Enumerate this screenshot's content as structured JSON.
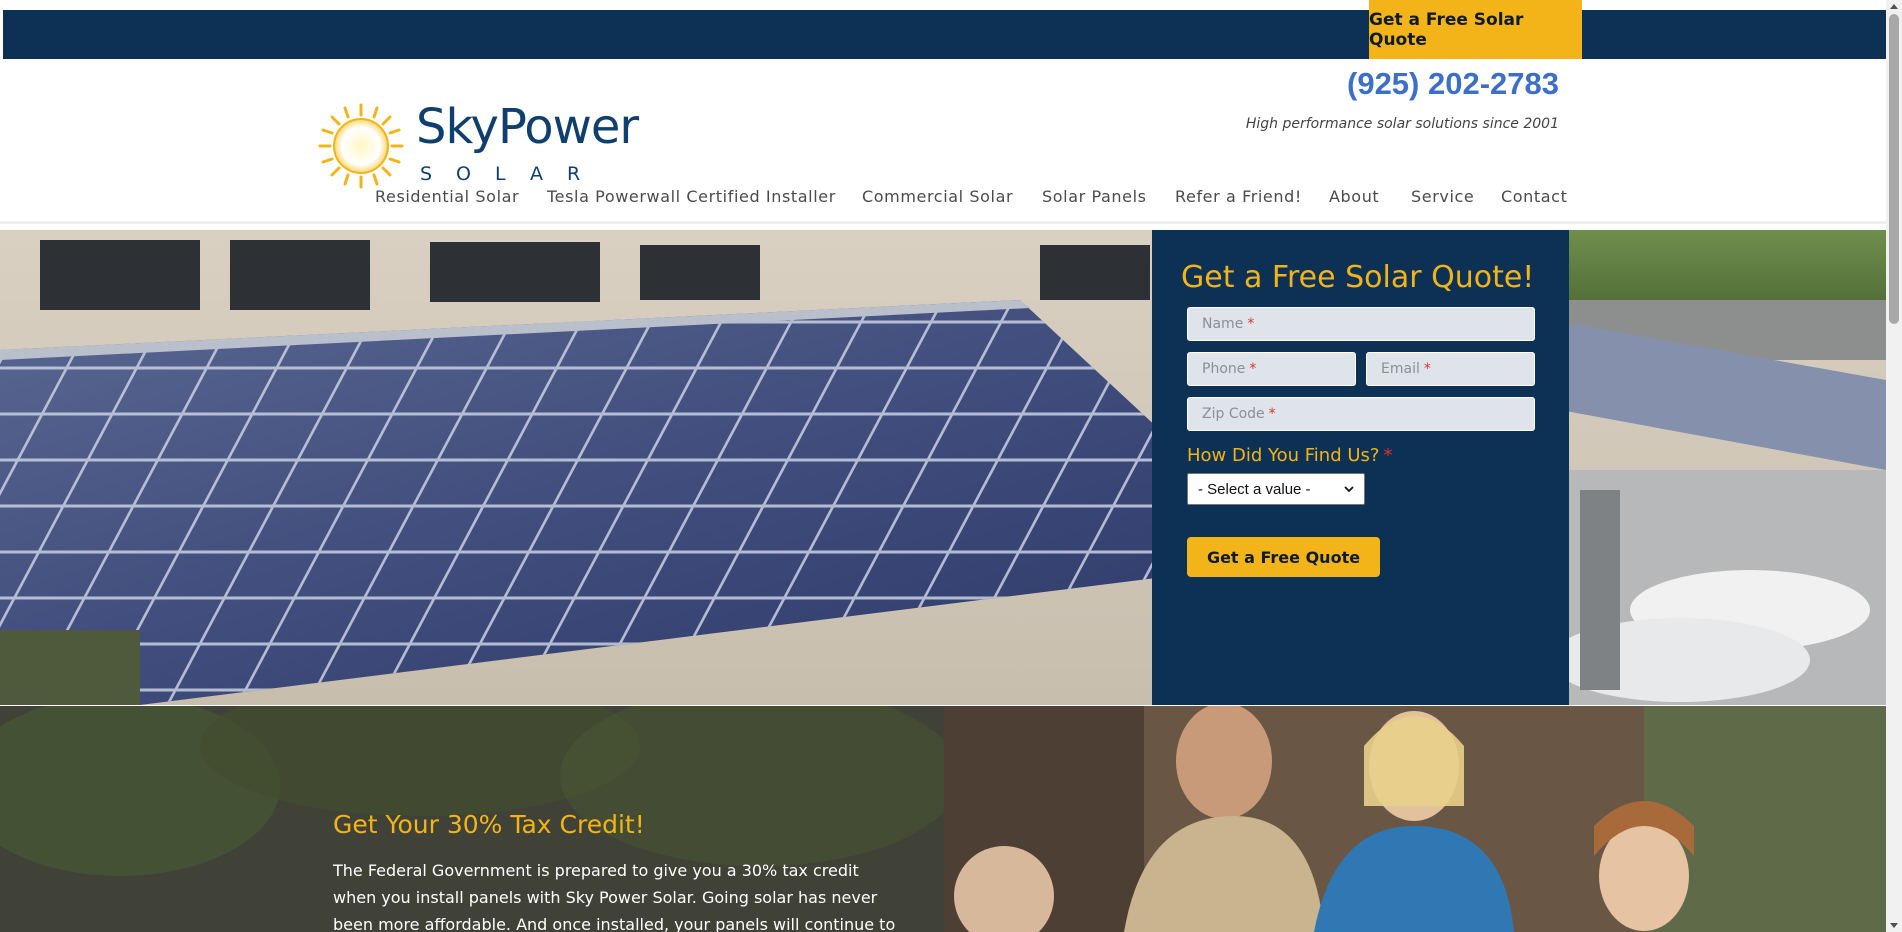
{
  "topbar": {
    "quote_label": "Get a Free Solar Quote"
  },
  "header": {
    "logo_name": "SkyPower",
    "logo_sub": "SOLAR",
    "phone": "(925) 202-2783",
    "tagline": "High performance solar solutions since 2001"
  },
  "nav": {
    "items": [
      "Residential Solar",
      "Tesla Powerwall Certified Installer",
      "Commercial Solar",
      "Solar Panels",
      "Refer a Friend!",
      "About",
      "Service",
      "Contact"
    ]
  },
  "quote_form": {
    "title": "Get a Free Solar Quote!",
    "fields": {
      "name": "Name",
      "phone": "Phone",
      "email": "Email",
      "zip": "Zip Code"
    },
    "required_marker": "*",
    "find_label": "How Did You Find Us?",
    "select_value": "- Select a value -",
    "submit_label": "Get a Free Quote"
  },
  "tax_section": {
    "title": "Get Your 30% Tax Credit!",
    "body": "The Federal Government is prepared to give you a 30% tax credit when you install panels with Sky Power Solar. Going solar has never been more affordable. And once installed, your panels will continue to"
  },
  "colors": {
    "navy": "#0d3154",
    "accent_yellow": "#f2b418",
    "phone_blue": "#3d6fc6"
  },
  "icons": [
    "sun-logo-icon",
    "chevron-down-icon"
  ]
}
